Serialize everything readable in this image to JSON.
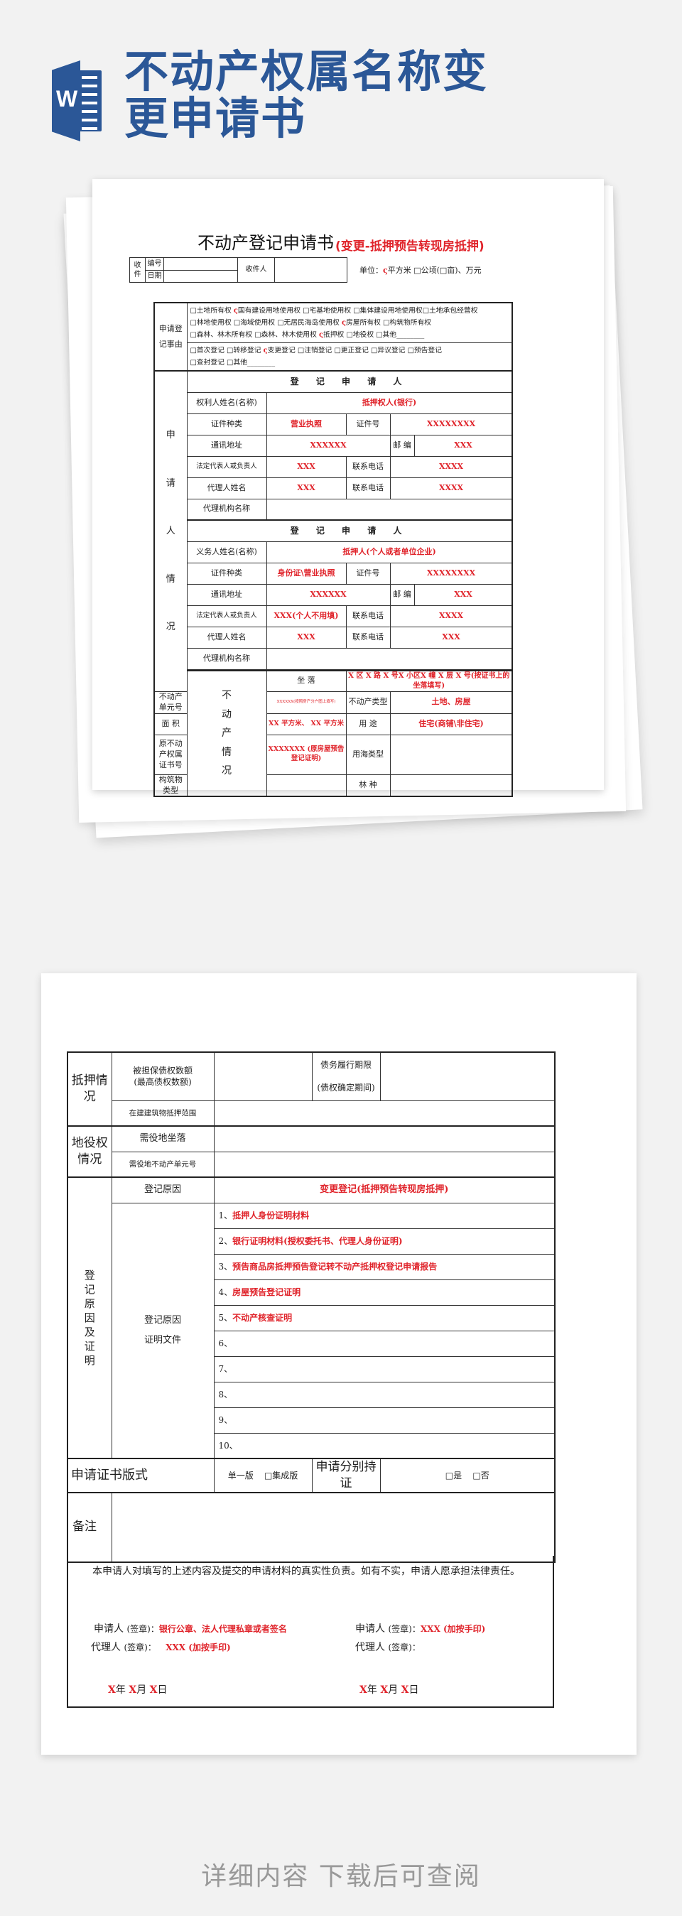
{
  "header": {
    "app_icon": "word-document-icon",
    "app_icon_letter": "W",
    "title": "不动产权属名称变更申请书"
  },
  "page1": {
    "form_title": "不动产登记申请书",
    "form_subtitle": "(变更-抵押预告转现房抵押)",
    "receipt": {
      "label": "收件",
      "number_label": "编号",
      "date_label": "日期",
      "receiver_label": "收件人"
    },
    "unit": {
      "label": "单位：",
      "check": "ς",
      "text": "平方米 □公顷(□亩)、万元"
    },
    "application_matter": {
      "label": "申请登记事由",
      "rights_line1_a": "□土地所有权 ",
      "rights_line1_check": "ς",
      "rights_line1_b": "国有建设用地使用权 □宅基地使用权 □集体建设用地使用权□土地承包经营权",
      "rights_line2_a": "□林地使用权 □海域使用权 □无居民海岛使用权 ",
      "rights_line2_check": "ς",
      "rights_line2_b": "房屋所有权 □构筑物所有权",
      "rights_line3_a": "□森林、林木所有权 □森林、林木使用权 ",
      "rights_line3_check": "ς",
      "rights_line3_b": "抵押权 □地役权 □其他________",
      "types_line1_a": "□首次登记 □转移登记 ",
      "types_line1_check": "ς",
      "types_line1_b": "变更登记 □注销登记 □更正登记 □异议登记 □预告登记",
      "types_line2": "□查封登记 □其他________"
    },
    "applicant_section_label": [
      "申",
      "请",
      "人",
      "情",
      "况"
    ],
    "right_holder": {
      "heading": "登 记 申 请 人",
      "name_label": "权利人姓名(名称)",
      "name_value": "抵押权人(银行)",
      "id_type_label": "证件种类",
      "id_type_value": "营业执照",
      "id_no_label": "证件号",
      "id_no_value": "XXXXXXXX",
      "address_label": "通讯地址",
      "address_value": "XXXXXX",
      "postcode_label": "邮 编",
      "postcode_value": "XXX",
      "legal_rep_label": "法定代表人或负责人",
      "legal_rep_value": "XXX",
      "phone_label": "联系电话",
      "phone_value": "XXXX",
      "agent_label": "代理人姓名",
      "agent_value": "XXX",
      "agent_phone_label": "联系电话",
      "agent_phone_value": "XXXX",
      "agency_label": "代理机构名称",
      "agency_value": ""
    },
    "obligor": {
      "heading": "登 记 申 请 人",
      "name_label": "义务人姓名(名称)",
      "name_value": "抵押人(个人或者单位企业)",
      "id_type_label": "证件种类",
      "id_type_value": "身份证\\营业执照",
      "id_no_label": "证件号",
      "id_no_value": "XXXXXXXX",
      "address_label": "通讯地址",
      "address_value": "XXXXXX",
      "postcode_label": "邮 编",
      "postcode_value": "XXX",
      "legal_rep_label": "法定代表人或负责人",
      "legal_rep_value": "XXX(个人不用填)",
      "phone_label": "联系电话",
      "phone_value": "XXXX",
      "agent_label": "代理人姓名",
      "agent_value": "XXX",
      "agent_phone_label": "联系电话",
      "agent_phone_value": "XXX",
      "agency_label": "代理机构名称",
      "agency_value": ""
    },
    "property": {
      "section_label": [
        "不",
        "动",
        "产",
        "情",
        "况"
      ],
      "location_label": "坐 落",
      "location_value": "X 区 X 路 X 号X 小区X 幢 X 层 X 号(按证书上的坐落填写)",
      "unit_no_label": "不动产单元号",
      "unit_no_value": "XXXXXX(按照房产分户图上填写)",
      "type_label": "不动产类型",
      "type_value": "土地、房屋",
      "area_label": "面 积",
      "area_value": "XX 平方米、 XX 平方米",
      "use_label": "用 途",
      "use_value": "住宅(商铺\\非住宅)",
      "orig_cert_label": "原不动产权属证书号",
      "orig_cert_value": "XXXXXXX (原房屋预告登记证明)",
      "sea_use_label": "用海类型",
      "structure_label": "构筑物类型",
      "forest_label": "林 种"
    }
  },
  "page2": {
    "mortgage": {
      "label": "抵押情况",
      "amount_label": "被担保债权数额",
      "amount_sub": "(最高债权数额)",
      "term_label": "债务履行期限",
      "term_sub": "(债权确定期间)",
      "scope_label": "在建建筑物抵押范围"
    },
    "easement": {
      "label": "地役权情况",
      "location_label": "需役地坐落",
      "unit_label": "需役地不动产单元号"
    },
    "reason": {
      "label": "登记原因及证明",
      "reason_label": "登记原因",
      "reason_value": "变更登记(抵押预告转现房抵押)",
      "docs_label": "登记原因",
      "docs_label2": "证明文件",
      "docs": [
        {
          "num": "1、",
          "text": "抵押人身份证明材料"
        },
        {
          "num": "2、",
          "text": "银行证明材料(授权委托书、代理人身份证明)"
        },
        {
          "num": "3、",
          "text": "预告商品房抵押预告登记转不动产抵押权登记申请报告"
        },
        {
          "num": "4、",
          "text": "房屋预告登记证明"
        },
        {
          "num": "5、",
          "text": "不动产核查证明"
        },
        {
          "num": "6、",
          "text": ""
        },
        {
          "num": "7、",
          "text": ""
        },
        {
          "num": "8、",
          "text": ""
        },
        {
          "num": "9、",
          "text": ""
        },
        {
          "num": "10、",
          "text": ""
        }
      ]
    },
    "cert_format": {
      "label": "申请证书版式",
      "option1": "单一版",
      "option2": "□集成版",
      "separate_label": "申请分别持证",
      "yes": "□是",
      "no": "□否"
    },
    "remarks_label": "备注",
    "declaration": "本申请人对填写的上述内容及提交的申请材料的真实性负责。如有不实，申请人愿承担法律责任。",
    "signatures": {
      "left_applicant_label": "申请人",
      "left_applicant_sub": "(签章)：",
      "left_applicant_value": "银行公章、法人代理私章或者签名",
      "left_agent_label": "代理人",
      "left_agent_sub": "(签章)：",
      "left_agent_value": "XXX (加按手印)",
      "right_applicant_label": "申请人",
      "right_applicant_sub": "(签章)：",
      "right_applicant_value": "XXX (加按手印)",
      "right_agent_label": "代理人",
      "right_agent_sub": "(签章)：",
      "date_x": "X",
      "year": "年",
      "month": "月",
      "day": "日"
    }
  },
  "footer": {
    "text": "详细内容 下载后可查阅"
  }
}
